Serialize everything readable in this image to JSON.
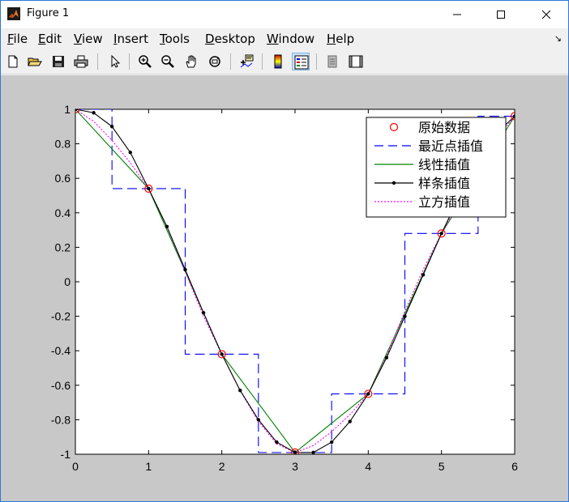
{
  "window": {
    "title": "Figure 1"
  },
  "menu": {
    "items": [
      {
        "label": "File",
        "ul": "F",
        "rest": "ile"
      },
      {
        "label": "Edit",
        "ul": "E",
        "rest": "dit"
      },
      {
        "label": "View",
        "ul": "V",
        "rest": "iew"
      },
      {
        "label": "Insert",
        "ul": "I",
        "rest": "nsert"
      },
      {
        "label": "Tools",
        "ul": "T",
        "rest": "ools"
      },
      {
        "label": "Desktop",
        "ul": "D",
        "rest": "esktop"
      },
      {
        "label": "Window",
        "ul": "W",
        "rest": "indow"
      },
      {
        "label": "Help",
        "ul": "H",
        "rest": "elp"
      }
    ]
  },
  "toolbar": {
    "icons": [
      "new-file-icon",
      "open-folder-icon",
      "save-icon",
      "print-icon",
      "edit-plot-arrow-icon",
      "zoom-in-icon",
      "zoom-out-icon",
      "pan-hand-icon",
      "rotate-3d-icon",
      "data-cursor-icon",
      "colorbar-icon",
      "legend-icon",
      "hide-plot-tools-icon",
      "show-plot-tools-icon"
    ]
  },
  "colors": {
    "figure_bg": "#c8c8c8",
    "original": "#ff0000",
    "nearest": "#0000ff",
    "linear": "#008000",
    "spline": "#000000",
    "cubic": "#ff00ff"
  },
  "chart_data": {
    "type": "line",
    "xlim": [
      0,
      6
    ],
    "ylim": [
      -1,
      1
    ],
    "xticks": [
      "0",
      "1",
      "2",
      "3",
      "4",
      "5",
      "6"
    ],
    "yticks": [
      "1",
      "0.8",
      "0.6",
      "0.4",
      "0.2",
      "0",
      "-0.2",
      "-0.4",
      "-0.6",
      "-0.8",
      "-1"
    ],
    "legend_position": "top-right",
    "series": [
      {
        "name": "原始数据",
        "style": "markers-circle",
        "color": "#ff0000",
        "x": [
          0,
          1,
          2,
          3,
          4,
          5,
          6
        ],
        "y": [
          1,
          0.54,
          -0.42,
          -0.99,
          -0.65,
          0.28,
          0.96
        ]
      },
      {
        "name": "最近点插值",
        "style": "dashed-step",
        "color": "#0000ff",
        "x": [
          0,
          0.5,
          0.5,
          1.5,
          1.5,
          2.5,
          2.5,
          3.5,
          3.5,
          4.5,
          4.5,
          5.5,
          5.5,
          6
        ],
        "y": [
          1,
          1,
          0.54,
          0.54,
          -0.42,
          -0.42,
          -0.99,
          -0.99,
          -0.65,
          -0.65,
          0.28,
          0.28,
          0.96,
          0.96
        ]
      },
      {
        "name": "线性插值",
        "style": "solid",
        "color": "#008000",
        "x": [
          0,
          1,
          2,
          3,
          4,
          5,
          6
        ],
        "y": [
          1,
          0.54,
          -0.42,
          -0.99,
          -0.65,
          0.28,
          0.96
        ]
      },
      {
        "name": "样条插值",
        "style": "solid-dots",
        "color": "#000000",
        "x": [
          0,
          0.25,
          0.5,
          0.75,
          1,
          1.25,
          1.5,
          1.75,
          2,
          2.25,
          2.5,
          2.75,
          3,
          3.25,
          3.5,
          3.75,
          4,
          4.25,
          4.5,
          4.75,
          5,
          5.25,
          5.5,
          5.75,
          6
        ],
        "y": [
          1,
          0.98,
          0.9,
          0.75,
          0.54,
          0.32,
          0.07,
          -0.18,
          -0.42,
          -0.63,
          -0.8,
          -0.93,
          -0.99,
          -0.99,
          -0.93,
          -0.81,
          -0.65,
          -0.44,
          -0.2,
          0.04,
          0.28,
          0.5,
          0.71,
          0.86,
          0.96
        ]
      },
      {
        "name": "立方插值",
        "style": "dotted",
        "color": "#ff00ff",
        "x": [
          0,
          0.25,
          0.5,
          0.75,
          1,
          1.25,
          1.5,
          1.75,
          2,
          2.25,
          2.5,
          2.75,
          3,
          3.25,
          3.5,
          3.75,
          4,
          4.25,
          4.5,
          4.75,
          5,
          5.25,
          5.5,
          5.75,
          6
        ],
        "y": [
          1,
          0.93,
          0.82,
          0.69,
          0.54,
          0.32,
          0.06,
          -0.2,
          -0.42,
          -0.63,
          -0.81,
          -0.94,
          -0.99,
          -0.95,
          -0.87,
          -0.77,
          -0.65,
          -0.43,
          -0.17,
          0.07,
          0.28,
          0.47,
          0.66,
          0.83,
          0.96
        ]
      }
    ]
  }
}
